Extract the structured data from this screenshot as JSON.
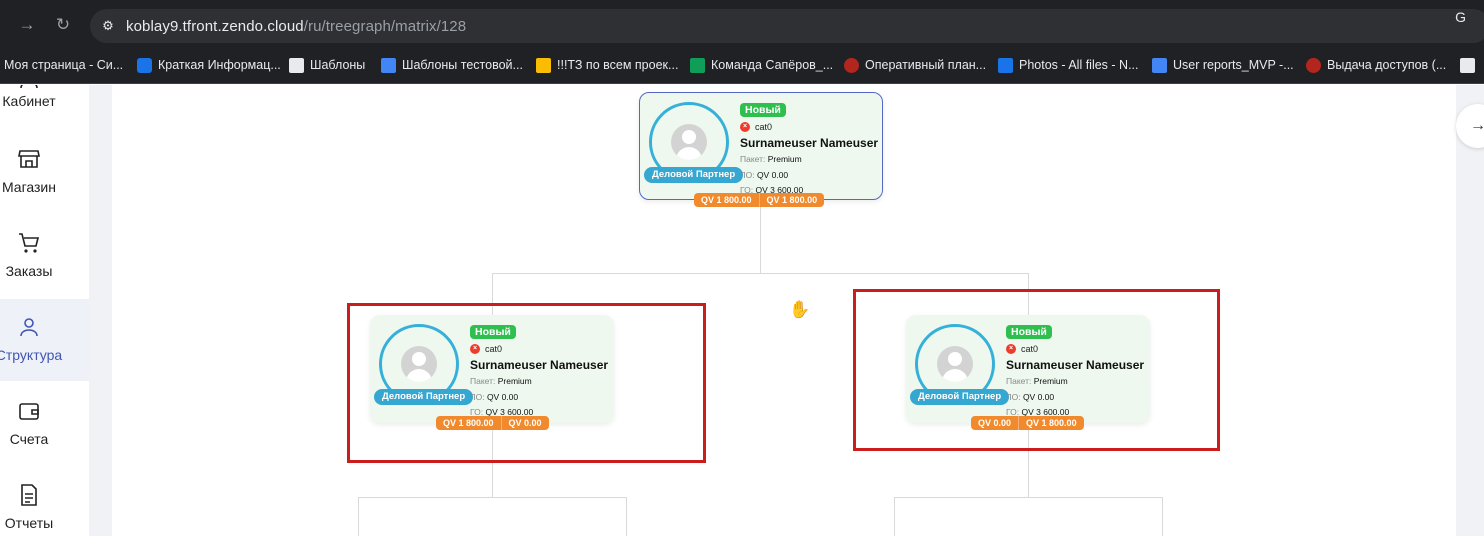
{
  "browser": {
    "url_host": "koblay9.tfront.zendo.cloud",
    "url_path": "/ru/treegraph/matrix/128",
    "right_glyph": "G",
    "bookmarks": [
      {
        "label": "Моя страница - Си...",
        "icon_color": "#202124"
      },
      {
        "label": "Краткая Информац...",
        "icon_color": "#1a73e8"
      },
      {
        "label": "Шаблоны",
        "icon_color": "#e8eaed"
      },
      {
        "label": "Шаблоны тестовой...",
        "icon_color": "#4285f4"
      },
      {
        "label": "!!!ТЗ по всем проек...",
        "icon_color": "#fbbc04"
      },
      {
        "label": "Команда Сапёров_...",
        "icon_color": "#0f9d58"
      },
      {
        "label": "Оперативный план...",
        "icon_color": "#b3261e"
      },
      {
        "label": "Photos - All files - N...",
        "icon_color": "#1a73e8"
      },
      {
        "label": "User reports_MVP -...",
        "icon_color": "#4285f4"
      },
      {
        "label": "Выдача доступов (...",
        "icon_color": "#b3261e"
      }
    ]
  },
  "sidebar": {
    "items": [
      {
        "label": "Кабинет",
        "active": false
      },
      {
        "label": "Магазин",
        "active": false
      },
      {
        "label": "Заказы",
        "active": false
      },
      {
        "label": "Структура",
        "active": true
      },
      {
        "label": "Счета",
        "active": false
      },
      {
        "label": "Отчеты",
        "active": false
      }
    ]
  },
  "tree": {
    "root": {
      "status": "Новый",
      "category": "cat0",
      "name": "Surnameuser Nameuser",
      "package_label": "Пакет:",
      "package": "Premium",
      "lo_label": "ЛО:",
      "lo": "QV 0.00",
      "go_label": "ГО:",
      "go": "QV 3 600.00",
      "role": "Деловой Партнер",
      "qv_left": "QV 1 800.00",
      "qv_right": "QV 1 800.00"
    },
    "left": {
      "status": "Новый",
      "category": "cat0",
      "name": "Surnameuser Nameuser",
      "package_label": "Пакет:",
      "package": "Premium",
      "lo_label": "ЛО:",
      "lo": "QV 0.00",
      "go_label": "ГО:",
      "go": "QV 3 600.00",
      "role": "Деловой Партнер",
      "qv_left": "QV 1 800.00",
      "qv_right": "QV 0.00"
    },
    "right": {
      "status": "Новый",
      "category": "cat0",
      "name": "Surnameuser Nameuser",
      "package_label": "Пакет:",
      "package": "Premium",
      "lo_label": "ЛО:",
      "lo": "QV 0.00",
      "go_label": "ГО:",
      "go": "QV 3 600.00",
      "role": "Деловой Партнер",
      "qv_left": "QV 0.00",
      "qv_right": "QV 1 800.00"
    }
  },
  "colors": {
    "accent": "#3f56b3",
    "card_bg": "#eef8ef",
    "status_new": "#2fbf4f",
    "qv_orange": "#f08a2c",
    "partner_blue": "#35a7d1",
    "highlight_red": "#cc1d1d"
  },
  "icons": {
    "back": "arrow-right-icon",
    "reload": "reload-icon",
    "site_info": "tune-icon",
    "scroll_right": "arrow-right-icon",
    "cursor": "grab-hand-icon"
  }
}
